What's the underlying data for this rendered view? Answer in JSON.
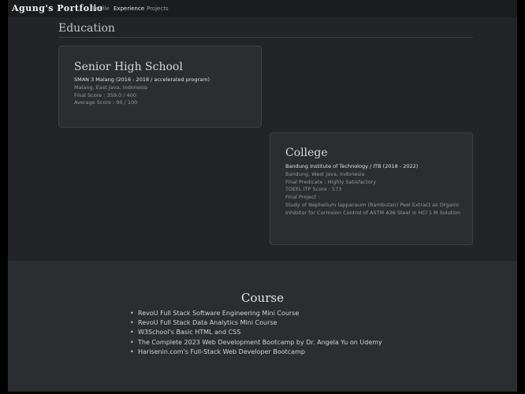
{
  "nav": {
    "brand": "Agung's Portfolio",
    "links": [
      {
        "label": "Profile",
        "active": false
      },
      {
        "label": "Experience",
        "active": true
      },
      {
        "label": "Projects",
        "active": false
      }
    ]
  },
  "education": {
    "title": "Education",
    "cards": [
      {
        "title": "Senior High School",
        "lines": [
          "SMAN 3 Malang (2016 - 2018 / accelerated program)",
          "Malang, East Java, Indonesia",
          "Final Score : 359.0 / 400",
          "Average Score : 90 / 100"
        ]
      },
      {
        "title": "College",
        "lines": [
          "Bandung Institute of Technology / ITB (2018 - 2022)",
          "Bandung, West Java, Indonesia",
          "Final Predicate : Highly Satisfactory",
          "TOEFL ITP Score : 573",
          "Final Project :",
          "Study of Nephelium lappaceum (Rambutan) Peel Extract as Organic Inhibitor for Corrosion Control of ASTM A36 Steel in HCl 1 M Solution"
        ]
      }
    ]
  },
  "course": {
    "title": "Course",
    "bullet": "•",
    "items": [
      "RevoU Full Stack Software Engineering Mini Course",
      "RevoU Full Stack Data Analytics Mini Course",
      "W3School's Basic HTML and CSS",
      "The Complete 2023 Web Development Bootcamp by Dr. Angela Yu on Udemy",
      "Harisenin.com's Full-Stack Web Developer Bootcamp"
    ]
  },
  "colors": {
    "page_bg": "#222428",
    "card_bg": "#2b2d31",
    "navbar_bg": "#1b1c1e",
    "text_primary": "#e6e7e9",
    "text_muted": "#96989c"
  }
}
